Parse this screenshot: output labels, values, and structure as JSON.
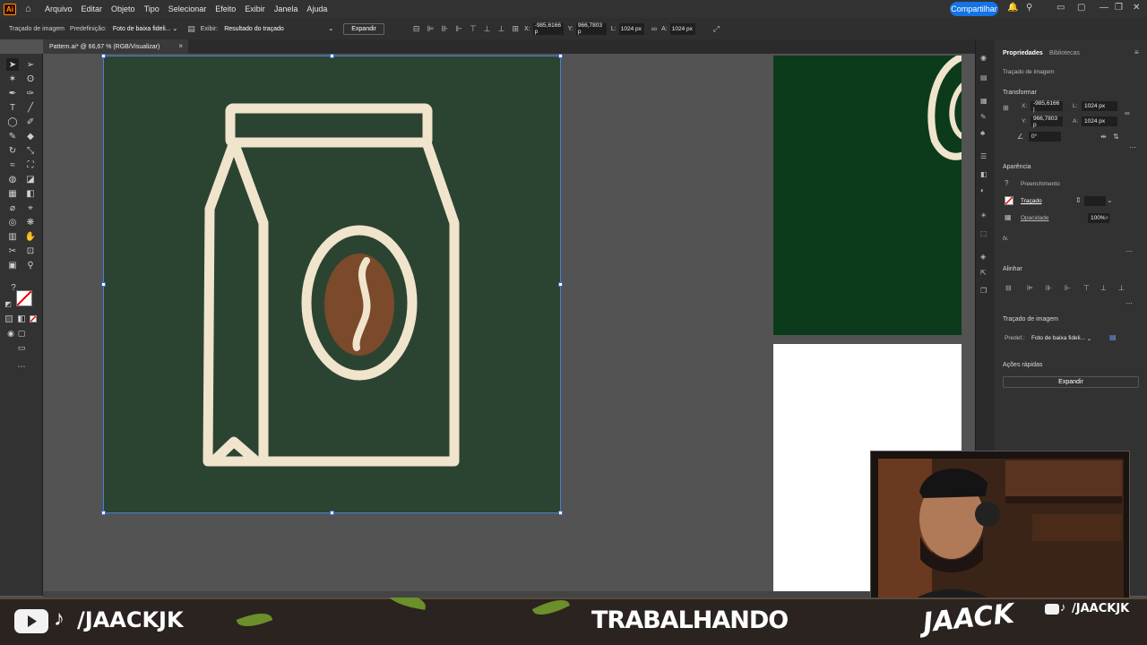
{
  "menubar": {
    "app_logo": "Ai",
    "items": [
      "Arquivo",
      "Editar",
      "Objeto",
      "Tipo",
      "Selecionar",
      "Efeito",
      "Exibir",
      "Janela",
      "Ajuda"
    ],
    "share_label": "Compartilhar"
  },
  "controlbar": {
    "context_label": "Traçado de imagem",
    "preset_label": "Predefinição:",
    "preset_value": "Foto de baixa fideli...",
    "view_label": "Exibir:",
    "view_value": "Resultado do traçado",
    "expand_button": "Expandir",
    "x_label": "X:",
    "x_value": "-985,6166 p",
    "y_label": "Y:",
    "y_value": "966,7803 p",
    "w_label": "L:",
    "w_value": "1024 px",
    "h_label": "A:",
    "h_value": "1024 px"
  },
  "document": {
    "tab_title": "Pattern.ai* @ 66,67 % (RGB/Visualizar)",
    "close_glyph": "×"
  },
  "panel": {
    "tabs": [
      "Propriedades",
      "Bibliotecas"
    ],
    "selection_title": "Traçado de imagem",
    "transform": {
      "title": "Transformar",
      "x_label": "X:",
      "x_value": "-985,6166 |",
      "y_label": "Y:",
      "y_value": "966,7803 p",
      "w_label": "L:",
      "w_value": "1024 px",
      "h_label": "A:",
      "h_value": "1024 px",
      "angle_value": "0°"
    },
    "appearance": {
      "title": "Aparência",
      "fill_label": "Preenchimento",
      "stroke_label": "Traçado",
      "opacity_label": "Opacidade",
      "opacity_value": "100%",
      "fx_label": "fx."
    },
    "align_title": "Alinhar",
    "trace": {
      "title": "Traçado de imagem",
      "preset_label": "Predef.:",
      "preset_value": "Foto de baixa fideli..."
    },
    "quick_actions": {
      "title": "Ações rápidas",
      "expand_button": "Expandir"
    }
  },
  "overlay": {
    "handle_left": "/JAACKJK",
    "status_text": "TRABALHANDO",
    "brand_logo": "JAACK",
    "handle_right": "/JAACKJK"
  },
  "colors": {
    "artboard_bg": "#2b4431",
    "icon_cream": "#f0e4cc",
    "bean_brown": "#7a4a2a",
    "accent_blue": "#1473e6"
  }
}
